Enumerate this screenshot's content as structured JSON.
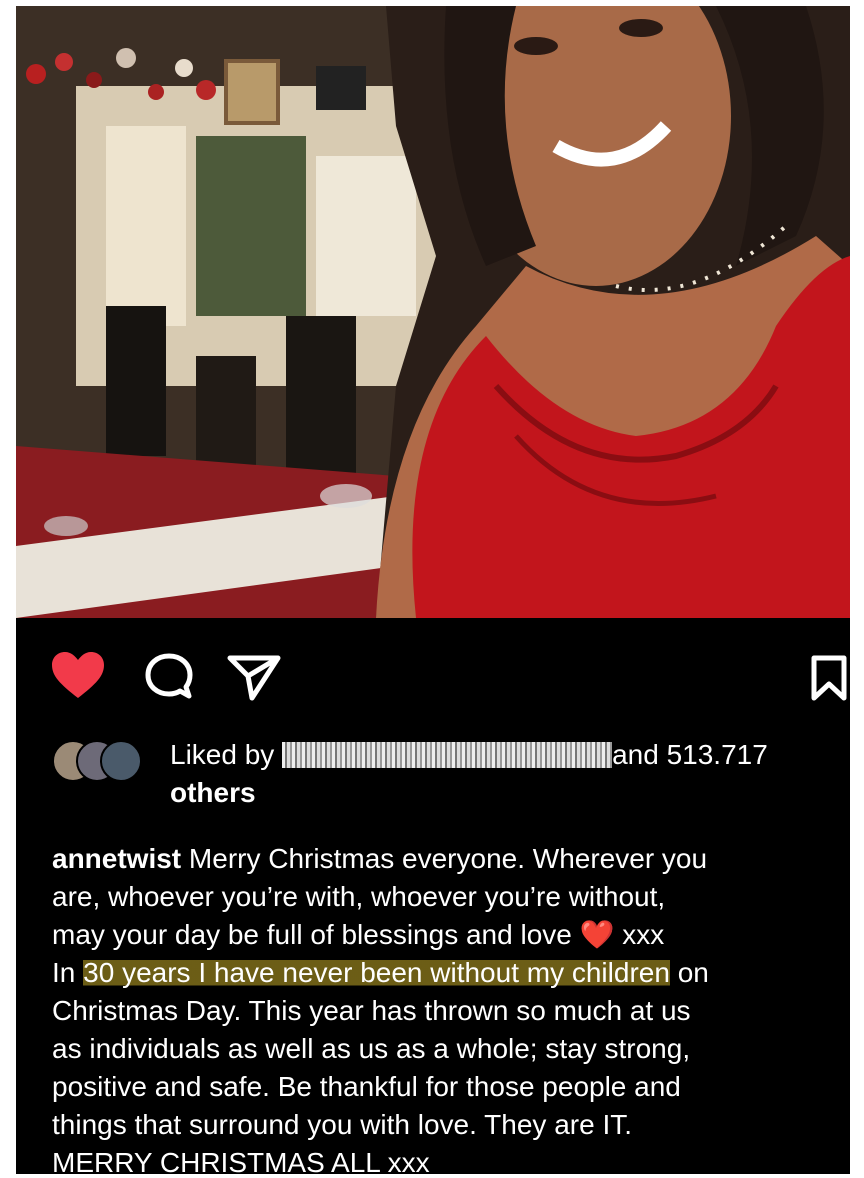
{
  "post": {
    "photo_alt": "",
    "liked_prefix": "Liked by",
    "liked_suffix": "and 513.717",
    "liked_others": "others",
    "username": "annetwist",
    "caption_line1": "Merry Christmas everyone. Wherever you",
    "caption_line2": "are, whoever you’re with, whoever you’re without,",
    "caption_line3": "may your day be full of blessings and love",
    "caption_heart": "❤️",
    "caption_line3b": "xxx",
    "caption_line4_pre": "In ",
    "caption_line4_hl": "30 years I have never been without my children",
    "caption_line4_post": " on",
    "caption_line5": "Christmas Day. This year has thrown so much at us",
    "caption_line6": "as individuals as well as us as a whole; stay strong,",
    "caption_line7": "positive and safe. Be thankful for those people and",
    "caption_line8": "things that surround you with love. They are IT.",
    "caption_line9": "MERRY CHRISTMAS ALL xxx"
  },
  "icons": {
    "like": "heart-icon",
    "comment": "comment-icon",
    "share": "send-icon",
    "save": "bookmark-icon"
  },
  "colors": {
    "like": "#f23a4a",
    "highlight": "#c4aa28",
    "dress": "#c2151c"
  }
}
